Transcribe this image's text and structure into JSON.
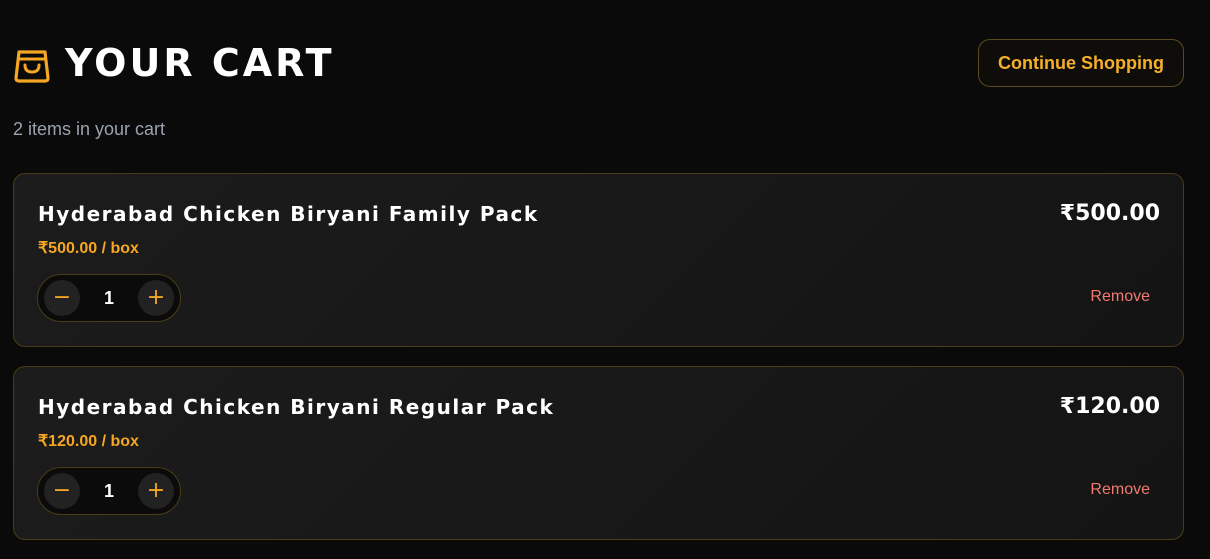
{
  "header": {
    "title": "YOUR CART",
    "continue_label": "Continue Shopping"
  },
  "summary": {
    "items_count_text": "2 items in your cart"
  },
  "cart": {
    "items": [
      {
        "name": "Hyderabad Chicken Biryani Family Pack",
        "unit_price": "₹500.00 / box",
        "total": "₹500.00",
        "quantity": "1",
        "remove_label": "Remove"
      },
      {
        "name": "Hyderabad Chicken Biryani Regular Pack",
        "unit_price": "₹120.00 / box",
        "total": "₹120.00",
        "quantity": "1",
        "remove_label": "Remove"
      }
    ],
    "minus_symbol": "−",
    "plus_symbol": "+"
  },
  "icons": {
    "title_icon": "shopping-bag-icon",
    "minus_icon": "minus-icon",
    "plus_icon": "plus-icon"
  },
  "colors": {
    "background": "#0a0a0a",
    "accent": "#f5a623",
    "remove": "#f07a6e",
    "muted_text": "#9aa3ad",
    "card_border": "#4a3c16"
  }
}
